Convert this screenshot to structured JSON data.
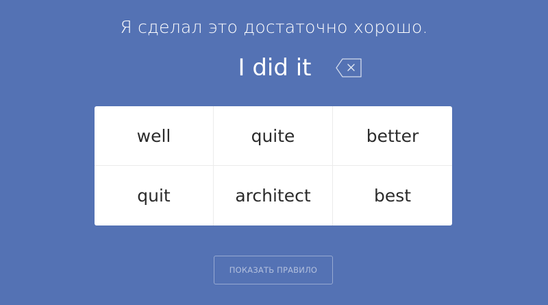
{
  "exercise": {
    "prompt": "Я сделал это достаточно хорошо.",
    "answer_so_far": "I did it"
  },
  "icons": {
    "backspace": "backspace-icon"
  },
  "options": [
    {
      "label": "well"
    },
    {
      "label": "quite"
    },
    {
      "label": "better"
    },
    {
      "label": "quit"
    },
    {
      "label": "architect"
    },
    {
      "label": "best"
    }
  ],
  "actions": {
    "show_rule_label": "ПОКАЗАТЬ ПРАВИЛО"
  },
  "colors": {
    "background": "#5472b4",
    "card": "#ffffff",
    "option_text": "#2b2b2b"
  }
}
